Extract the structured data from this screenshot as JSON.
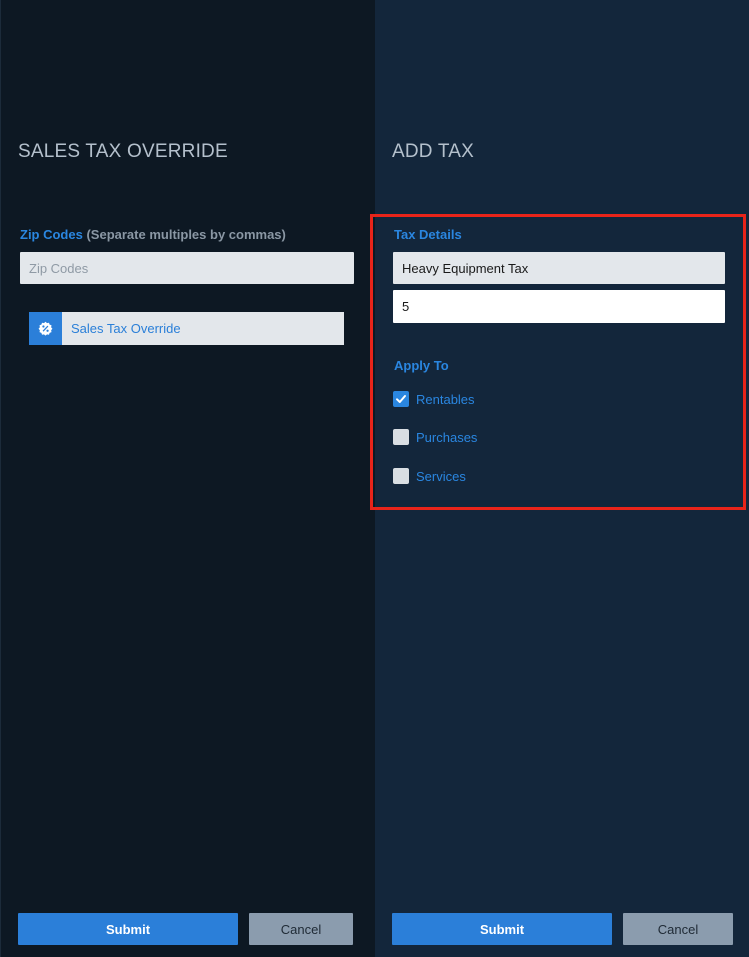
{
  "left_panel": {
    "title": "SALES TAX OVERRIDE",
    "zip_label": "Zip Codes",
    "zip_hint": "(Separate multiples by commas)",
    "zip_placeholder": "Zip Codes",
    "zip_value": "",
    "override_chip_label": "Sales Tax Override",
    "override_chip_icon": "percent-badge-icon",
    "submit_label": "Submit",
    "cancel_label": "Cancel"
  },
  "right_panel": {
    "title": "ADD TAX",
    "tax_details_label": "Tax Details",
    "tax_name_value": "Heavy Equipment Tax",
    "tax_rate_value": "5",
    "apply_to_label": "Apply To",
    "options": [
      {
        "label": "Rentables",
        "checked": true
      },
      {
        "label": "Purchases",
        "checked": false
      },
      {
        "label": "Services",
        "checked": false
      }
    ],
    "submit_label": "Submit",
    "cancel_label": "Cancel"
  },
  "colors": {
    "left_bg": "#0d1823",
    "right_bg": "#13263b",
    "accent_blue": "#2a86e0",
    "highlight_red": "#e8241a",
    "cancel_gray": "#8b9cae"
  }
}
